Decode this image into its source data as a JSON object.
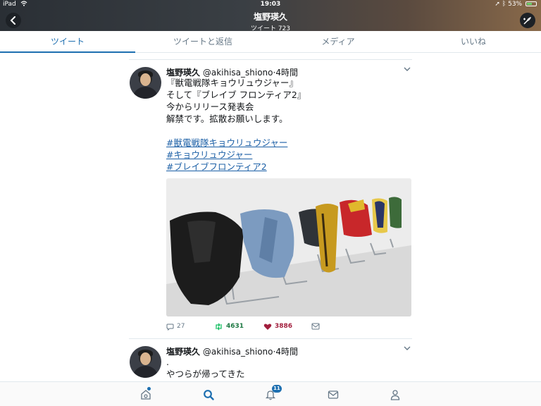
{
  "status_bar": {
    "device": "iPad",
    "time": "19:03",
    "battery": "53%"
  },
  "header": {
    "name": "塩野瑛久",
    "tweet_count": "ツイート 723"
  },
  "tabs": [
    {
      "label": "ツイート",
      "active": true
    },
    {
      "label": "ツイートと返信",
      "active": false
    },
    {
      "label": "メディア",
      "active": false
    },
    {
      "label": "いいね",
      "active": false
    }
  ],
  "tweets": [
    {
      "name": "塩野瑛久",
      "handle": "@akihisa_shiono",
      "time": "·4時間",
      "lines": [
        "『獣電戦隊キョウリュウジャー』",
        "そして『ブレイブ フロンティア2』",
        "今からリリース発表会",
        "解禁です。拡散お願いします。"
      ],
      "hashtags": [
        "#獣電戦隊キョウリュウジャー",
        "#キョウリュウジャー",
        "#ブレイブフロンティア2"
      ],
      "replies": "27",
      "retweets": "4631",
      "likes": "3886"
    },
    {
      "name": "塩野瑛久",
      "handle": "@akihisa_shiono",
      "time": "·4時間",
      "lines": [
        ".",
        "やつらが帰ってきた"
      ]
    }
  ],
  "tabbar": {
    "notification_count": "11"
  },
  "colors": {
    "accent": "#1d6fb0",
    "retweet": "#17bf63",
    "like": "#a21e3d"
  }
}
